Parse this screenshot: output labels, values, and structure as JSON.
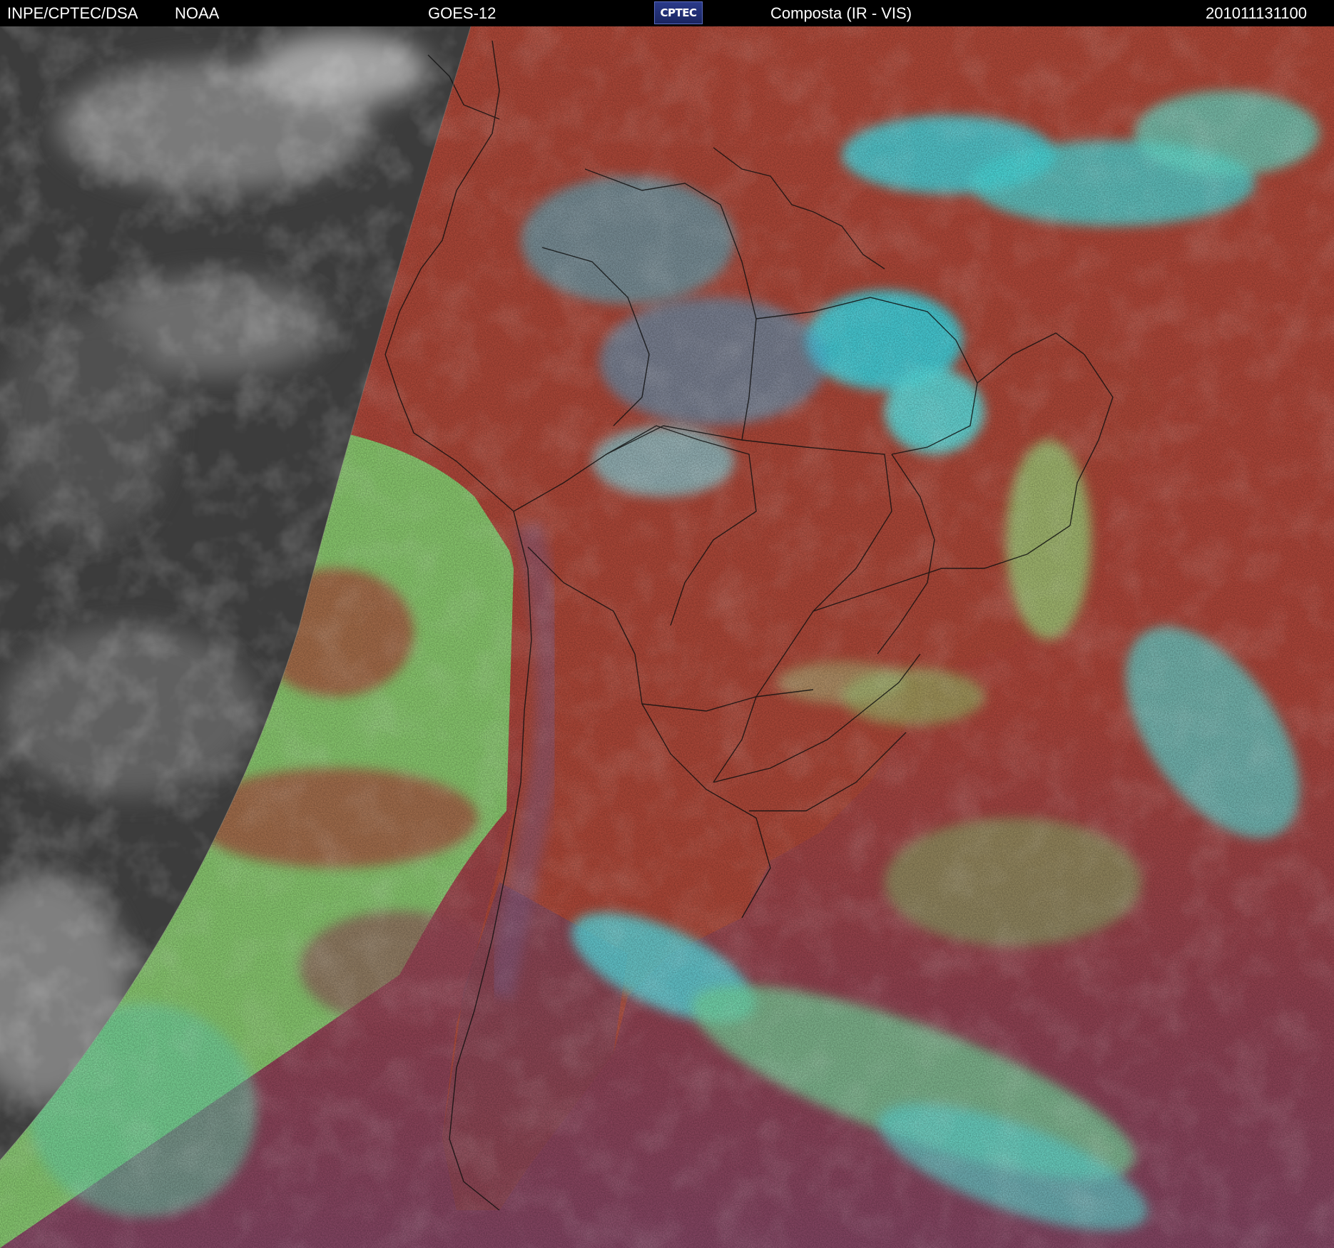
{
  "header": {
    "agency": "INPE/CPTEC/DSA",
    "source": "NOAA",
    "satellite": "GOES-12",
    "logo_text": "CPTEC",
    "product": "Composta (IR - VIS)",
    "timestamp": "201011131100"
  },
  "colors": {
    "night_gray": "#3f3f3f",
    "land_red": "#b84a3a",
    "ocean_red": "#b8503e",
    "low_cloud_green": "#8fe07a",
    "high_cloud_cyan": "#40e8f0",
    "south_magenta": "#8a4a68",
    "border_line": "#111111"
  }
}
